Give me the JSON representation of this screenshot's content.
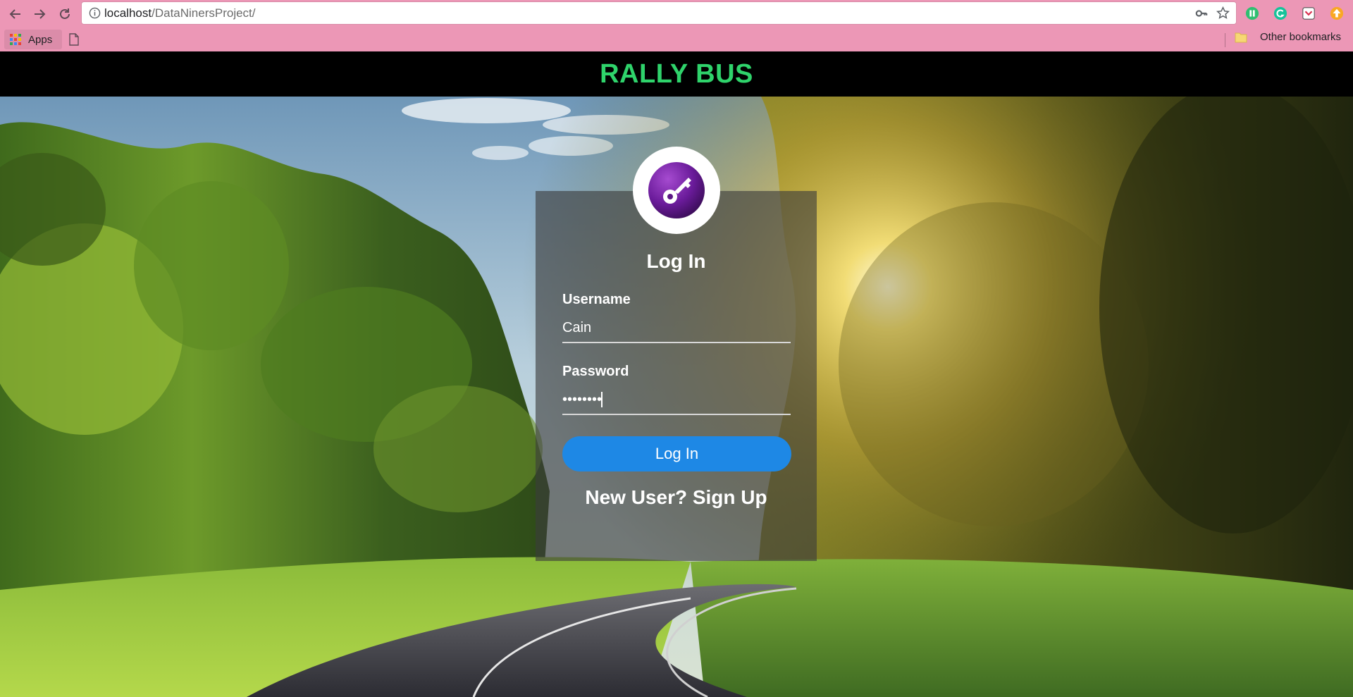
{
  "browser": {
    "url_host": "localhost",
    "url_path": "/DataNinersProject/",
    "bookmarks": {
      "apps_label": "Apps",
      "other_label": "Other bookmarks"
    }
  },
  "header": {
    "title": "RALLY BUS"
  },
  "login": {
    "title": "Log In",
    "username_label": "Username",
    "username_value": "Cain",
    "password_label": "Password",
    "password_value": "••••••••",
    "submit_label": "Log In",
    "signup_label": "New User? Sign Up"
  },
  "colors": {
    "chrome": "#ec97b6",
    "title": "#2fd36b",
    "button": "#1e88e5",
    "key_icon": "#6a1b9a"
  }
}
